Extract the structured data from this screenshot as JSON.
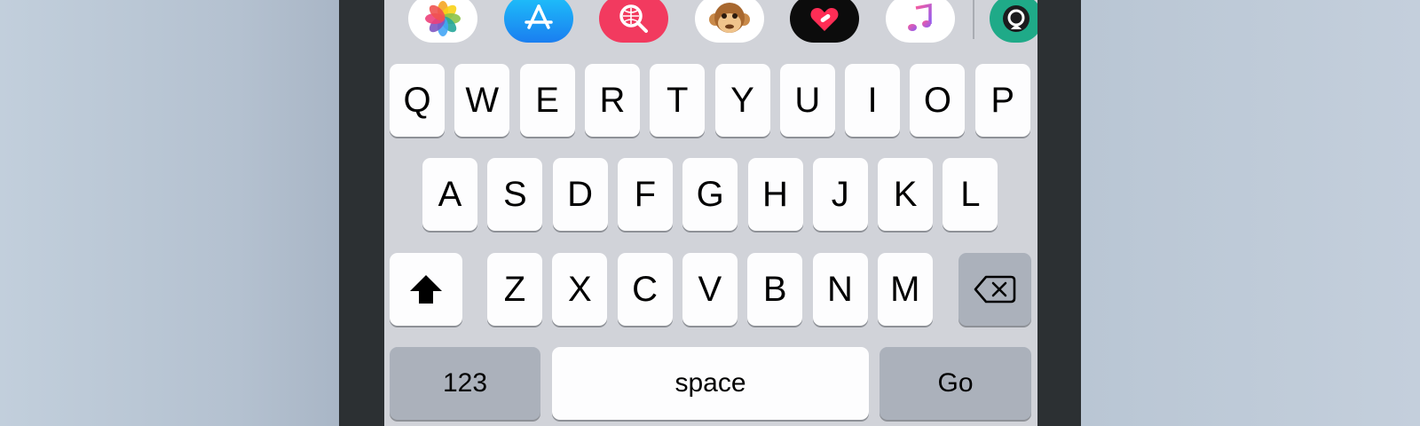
{
  "colors": {
    "background": "#c4cfdc",
    "frame": "#2c3033",
    "keyboard": "#d1d3d9",
    "letter_key": "#fdfdfe",
    "function_key": "#abb1bb",
    "key_shadow": "#8e9197"
  },
  "app_strip": {
    "apps": [
      {
        "icon": "photos-icon"
      },
      {
        "icon": "app-store-icon"
      },
      {
        "icon": "image-search-icon"
      },
      {
        "icon": "animoji-monkey-icon"
      },
      {
        "icon": "digital-touch-heart-icon"
      },
      {
        "icon": "music-icon"
      },
      {
        "icon": "partial-app-icon"
      }
    ]
  },
  "keyboard": {
    "row1": [
      "Q",
      "W",
      "E",
      "R",
      "T",
      "Y",
      "U",
      "I",
      "O",
      "P"
    ],
    "row2": [
      "A",
      "S",
      "D",
      "F",
      "G",
      "H",
      "J",
      "K",
      "L"
    ],
    "row3": [
      "Z",
      "X",
      "C",
      "V",
      "B",
      "N",
      "M"
    ],
    "shift_icon": "shift-arrow-icon",
    "delete_icon": "delete-backspace-icon",
    "numbers_label": "123",
    "space_label": "space",
    "return_label": "Go"
  }
}
